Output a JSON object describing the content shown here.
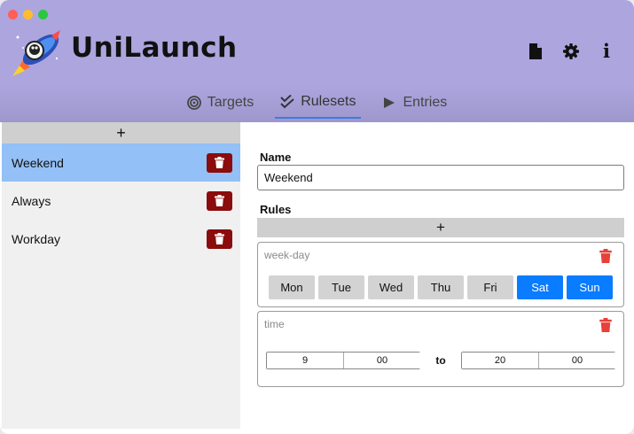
{
  "window": {
    "traffic_lights": [
      "close",
      "minimize",
      "maximize"
    ]
  },
  "header": {
    "app_title": "UniLaunch",
    "logo_icon": "rocket-astronaut-icon",
    "actions": [
      {
        "name": "document-icon"
      },
      {
        "name": "gear-icon"
      },
      {
        "name": "info-icon",
        "glyph": "i"
      }
    ]
  },
  "tabs": [
    {
      "label": "Targets",
      "icon": "target-icon",
      "active": false
    },
    {
      "label": "Rulesets",
      "icon": "double-check-icon",
      "active": true
    },
    {
      "label": "Entries",
      "icon": "play-icon",
      "active": false
    }
  ],
  "sidebar": {
    "add_label": "+",
    "items": [
      {
        "label": "Weekend",
        "selected": true
      },
      {
        "label": "Always",
        "selected": false
      },
      {
        "label": "Workday",
        "selected": false
      }
    ]
  },
  "main": {
    "name_label": "Name",
    "name_value": "Weekend",
    "rules_label": "Rules",
    "rules_add_label": "+",
    "weekday_rule": {
      "type": "week-day",
      "days": [
        {
          "label": "Mon",
          "on": false
        },
        {
          "label": "Tue",
          "on": false
        },
        {
          "label": "Wed",
          "on": false
        },
        {
          "label": "Thu",
          "on": false
        },
        {
          "label": "Fri",
          "on": false
        },
        {
          "label": "Sat",
          "on": true
        },
        {
          "label": "Sun",
          "on": true
        }
      ]
    },
    "time_rule": {
      "type": "time",
      "from_hour": "9",
      "from_minute": "00",
      "to_label": "to",
      "to_hour": "20",
      "to_minute": "00"
    }
  },
  "colors": {
    "header_bg": "#ada5de",
    "selected_item": "#93c0f6",
    "delete_button": "#8b0c0c",
    "day_on": "#0a7cff",
    "rule_trash": "#e8403a",
    "active_tab_underline": "#3f7be0"
  }
}
